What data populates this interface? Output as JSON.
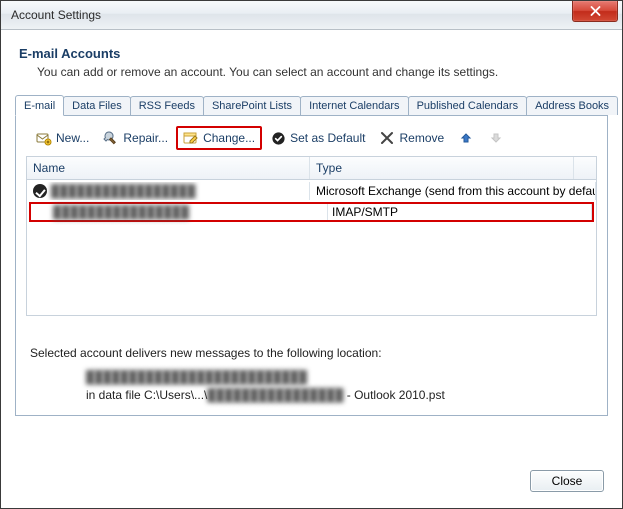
{
  "window": {
    "title": "Account Settings"
  },
  "heading": {
    "title": "E-mail Accounts",
    "subtitle": "You can add or remove an account. You can select an account and change its settings."
  },
  "tabs": {
    "email": "E-mail",
    "datafiles": "Data Files",
    "rss": "RSS Feeds",
    "sharepoint": "SharePoint Lists",
    "internetcal": "Internet Calendars",
    "pubcal": "Published Calendars",
    "addressbooks": "Address Books"
  },
  "toolbar": {
    "new": "New...",
    "repair": "Repair...",
    "change": "Change...",
    "setdefault": "Set as Default",
    "remove": "Remove"
  },
  "columns": {
    "name": "Name",
    "type": "Type"
  },
  "accounts": [
    {
      "name": "█████████████████",
      "type": "Microsoft Exchange (send from this account by default)",
      "is_default": true
    },
    {
      "name": "████████████████",
      "type": "IMAP/SMTP",
      "is_default": false
    }
  ],
  "delivery": {
    "intro": "Selected account delivers new messages to the following location:",
    "folder": "██████████████████████████",
    "path_prefix": "in data file C:\\Users\\...\\",
    "path_blur": "████████████████",
    "path_suffix": " - Outlook 2010.pst"
  },
  "buttons": {
    "close": "Close"
  }
}
